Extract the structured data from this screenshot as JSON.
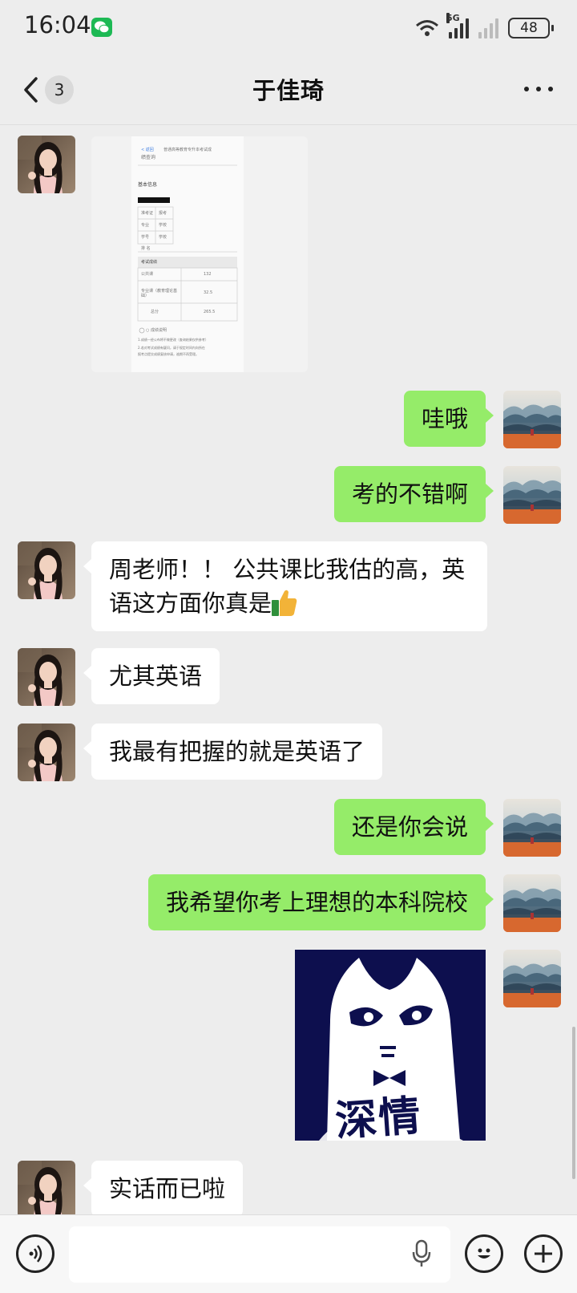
{
  "status_bar": {
    "time": "16:04",
    "network": "5G",
    "battery": "48",
    "app_icon": "wechat-icon"
  },
  "header": {
    "back_icon": "chevron-left-icon",
    "unread_count": "3",
    "title": "于佳琦",
    "more_icon": "more-dots-icon"
  },
  "contact": {
    "avatar": "portrait-photo",
    "self_avatar": "mountain-landscape-painting"
  },
  "messages": [
    {
      "from": "contact",
      "type": "image",
      "content": "screenshot-of-exam-score-document"
    },
    {
      "from": "self",
      "type": "text",
      "text": "哇哦"
    },
    {
      "from": "self",
      "type": "text",
      "text": "考的不错啊"
    },
    {
      "from": "contact",
      "type": "text",
      "text_line1": "周老师！！ 公共课比我估的高，英",
      "text_line2": "语这方面你真是",
      "emoji": "thumbs-up-icon"
    },
    {
      "from": "contact",
      "type": "text",
      "text": "尤其英语"
    },
    {
      "from": "contact",
      "type": "text",
      "text": "我最有把握的就是英语了"
    },
    {
      "from": "self",
      "type": "text",
      "text": "还是你会说"
    },
    {
      "from": "self",
      "type": "text",
      "text": "我希望你考上理想的本科院校"
    },
    {
      "from": "self",
      "type": "sticker",
      "caption": "深情"
    },
    {
      "from": "contact",
      "type": "text",
      "text": "实话而已啦"
    }
  ],
  "doc_image": {
    "back": "< 返回",
    "heading1": "普通高等教育专升本考试成",
    "heading2": "绩查询",
    "section_basic": "基本信息",
    "grid": [
      "准考证",
      "报考",
      "专业",
      "学校",
      "学号",
      "学校"
    ],
    "rank_label": "排  名",
    "scores_title": "考试成绩",
    "row1_label": "公共课",
    "row1_value": "132",
    "row2_label": "专业课（教育理论基础）",
    "row2_value": "32.5",
    "row3_label": "总分",
    "row3_value": "265.5",
    "note1": "○ 成绩说明",
    "note2": "1.成绩一经公布将不做更改（查询结果仅供参考）",
    "note3": "2.若对考试成绩有疑问，请于规定时间内向所在",
    "note4": "报考点提交成绩复核申请，逾期不再受理。"
  },
  "composer": {
    "voice_icon": "voice-input-icon",
    "placeholder": "",
    "mic_icon": "microphone-icon",
    "emoji_icon": "emoji-icon",
    "plus_icon": "plus-icon"
  },
  "colors": {
    "background": "#ededed",
    "incoming_bubble": "#ffffff",
    "outgoing_bubble": "#95ec69",
    "sticker_bg": "#0d0f4e"
  }
}
